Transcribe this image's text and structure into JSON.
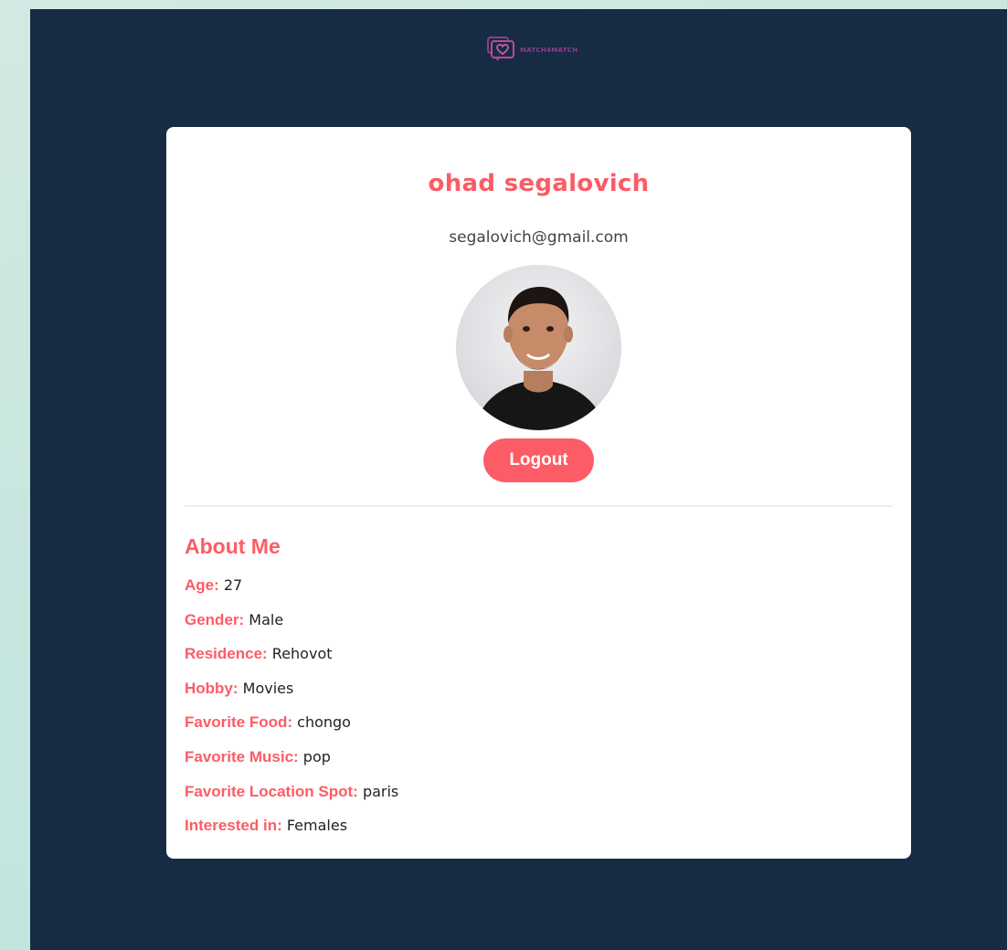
{
  "brand": {
    "logo_text": "MATCH4MATCH",
    "icon": "heart-chat-icon"
  },
  "profile": {
    "name": "ohad segalovich",
    "email": "segalovich@gmail.com",
    "avatar_icon": "profile-photo"
  },
  "actions": {
    "logout_label": "Logout"
  },
  "about": {
    "title": "About Me",
    "items": [
      {
        "label": "Age:",
        "value": "27"
      },
      {
        "label": "Gender:",
        "value": "Male"
      },
      {
        "label": "Residence:",
        "value": "Rehovot"
      },
      {
        "label": "Hobby:",
        "value": "Movies"
      },
      {
        "label": "Favorite Food:",
        "value": "chongo"
      },
      {
        "label": "Favorite Music:",
        "value": "pop"
      },
      {
        "label": "Favorite Location Spot:",
        "value": "paris"
      },
      {
        "label": "Interested in:",
        "value": "Females"
      }
    ]
  },
  "colors": {
    "accent": "#fc5c65",
    "page_background": "#172b43",
    "card_background": "#ffffff",
    "brand_purple": "#8e3f8c"
  }
}
